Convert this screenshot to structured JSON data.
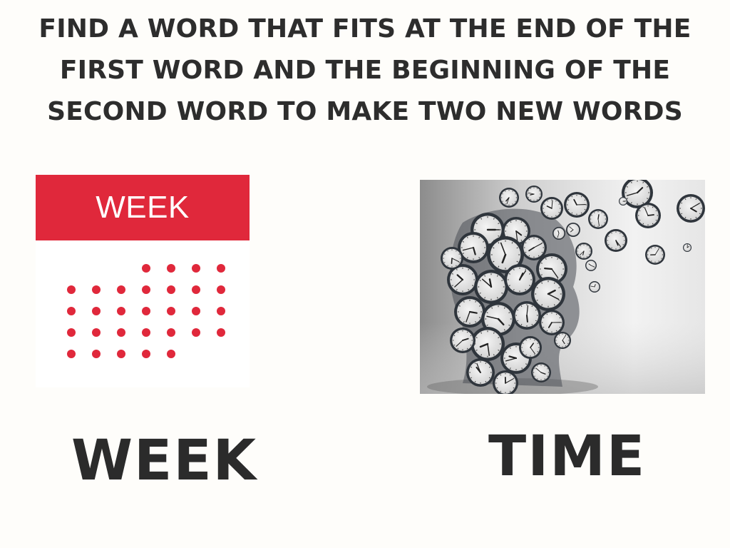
{
  "title_lines": [
    "FIND A WORD THAT FITS AT THE END OF THE",
    "FIRST WORD AND THE BEGINNING OF THE",
    "SECOND WORD TO MAKE TWO NEW WORDS"
  ],
  "calendar_image": {
    "header_text": "WEEK",
    "accent_color": "#e0283b",
    "dot_rows": [
      4,
      7,
      7,
      7,
      5
    ],
    "icon": "calendar-icon"
  },
  "clocks_image": {
    "icon": "clock-head-illustration"
  },
  "left_word": "WEEK",
  "right_word": "TIME"
}
